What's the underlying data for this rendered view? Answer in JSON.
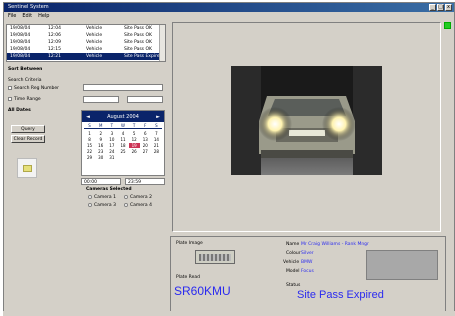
{
  "window": {
    "title": "Sentinel System"
  },
  "menu": [
    {
      "label": "File"
    },
    {
      "label": "Edit"
    },
    {
      "label": "Help"
    }
  ],
  "title_buttons": [
    {
      "label": "_"
    },
    {
      "label": "□"
    },
    {
      "label": "x"
    }
  ],
  "status_led_color": "#22cc22",
  "event_list": {
    "rows": [
      {
        "c1": "19/08/04",
        "c2": "12:04",
        "c3": "Vehicle",
        "c4": "Site Pass OK",
        "selected": false
      },
      {
        "c1": "19/08/04",
        "c2": "12:06",
        "c3": "Vehicle",
        "c4": "Site Pass OK",
        "selected": false
      },
      {
        "c1": "19/08/04",
        "c2": "12:09",
        "c3": "Vehicle",
        "c4": "Site Pass OK",
        "selected": false
      },
      {
        "c1": "19/08/04",
        "c2": "12:15",
        "c3": "Vehicle",
        "c4": "Site Pass OK",
        "selected": false
      },
      {
        "c1": "19/08/04",
        "c2": "12:21",
        "c3": "Vehicle",
        "c4": "Site Pass Expired",
        "selected": true
      }
    ]
  },
  "filters": {
    "heading": "Sort Between",
    "subheading": "Search Criteria",
    "option1": "Search Reg Number",
    "option2": "Time Range",
    "option3": "All Dates",
    "query_label": "Query",
    "clear_label": "Clear Record"
  },
  "calendar": {
    "month": "August 2004",
    "prev": "◄",
    "next": "►",
    "dow": [
      "S",
      "M",
      "T",
      "W",
      "T",
      "F",
      "S"
    ],
    "days": [
      "",
      "",
      "",
      "",
      "",
      "",
      "",
      "1",
      "2",
      "3",
      "4",
      "5",
      "6",
      "7",
      "8",
      "9",
      "10",
      "11",
      "12",
      "13",
      "14",
      "15",
      "16",
      "17",
      "18",
      "19",
      "20",
      "21",
      "22",
      "23",
      "24",
      "25",
      "26",
      "27",
      "28",
      "29",
      "30",
      "31"
    ],
    "today": "19"
  },
  "camera_select": {
    "heading": "Cameras Selected",
    "cam1": "Camera 1",
    "cam2": "Camera 2",
    "cam3": "Camera 3",
    "cam4": "Camera 4",
    "left_value": "00:00",
    "right_value": "23:59"
  },
  "details": {
    "plate_caption": "Plate Image",
    "reg_caption": "Plate Read",
    "reg_number": "SR60KMU",
    "name_label": "Name",
    "name_value": "Mr Craig Williams - Rank Mngr",
    "colour_label": "Colour",
    "colour_value": "Silver",
    "vehicle_label": "Vehicle",
    "vehicle_value": "BMW",
    "model_label": "Model",
    "model_value": "Focus",
    "status_label": "Status",
    "status_message": "Site Pass Expired"
  }
}
